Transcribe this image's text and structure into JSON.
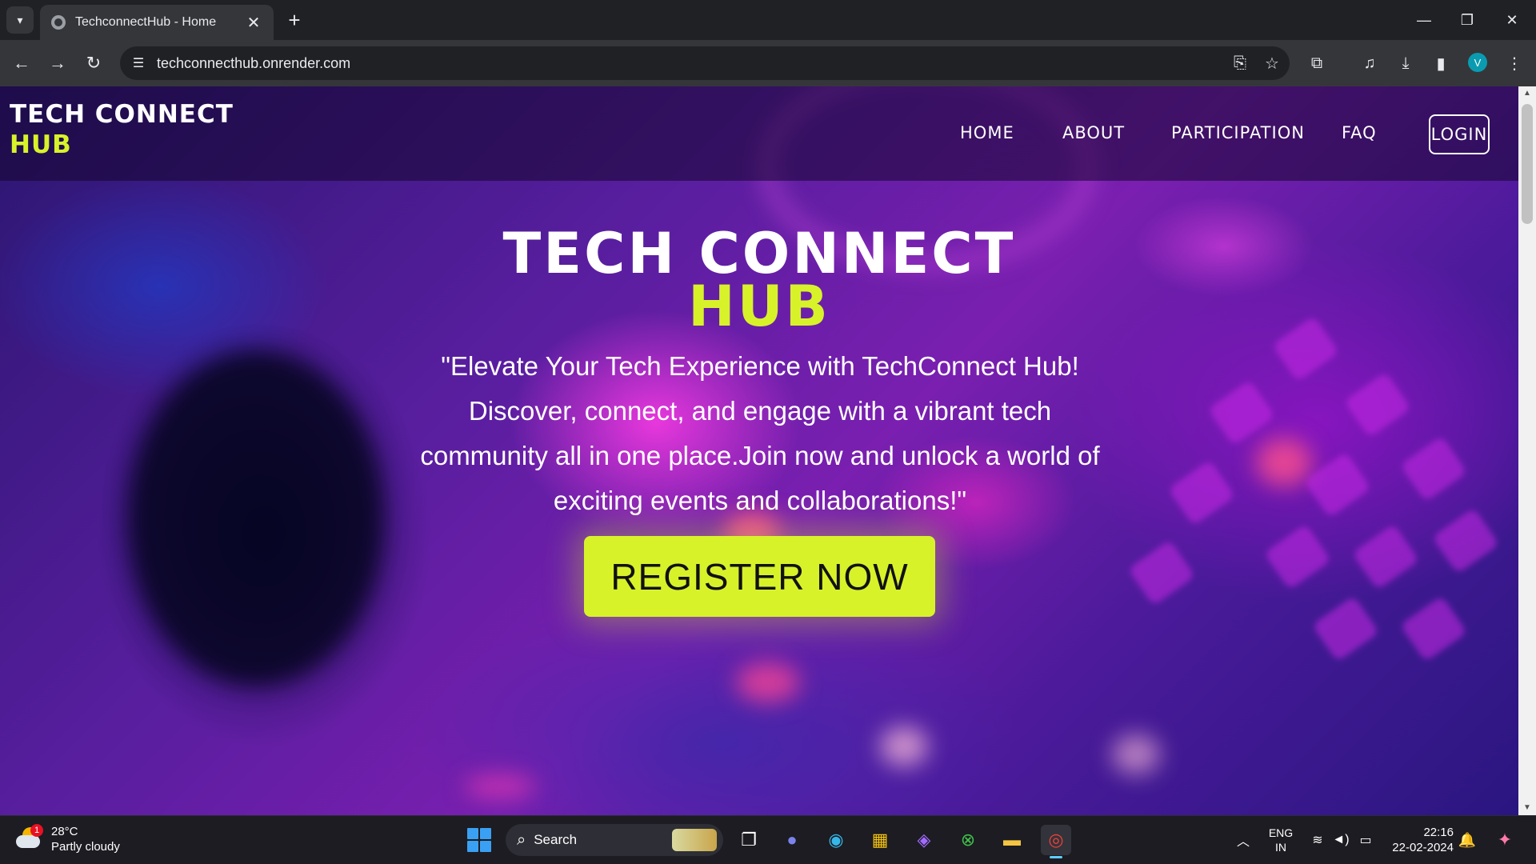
{
  "browser": {
    "tab_title": "TechconnectHub - Home",
    "url": "techconnecthub.onrender.com",
    "profile_initial": "V",
    "new_tab_symbol": "+",
    "close_symbol": "✕"
  },
  "site": {
    "logo_line1": "TECH CONNECT",
    "logo_line2": "HUB",
    "nav": {
      "home": "HOME",
      "about": "ABOUT",
      "participation": "PARTICIPATION",
      "faq": "FAQ",
      "login": "LOGIN"
    },
    "hero": {
      "title_line1": "TECH CONNECT",
      "title_line2": "HUB",
      "tagline": "\"Elevate Your Tech Experience with TechConnect Hub! Discover, connect, and engage with a vibrant tech community all in one place.Join now and unlock a world of exciting events and collaborations!\"",
      "cta": "REGISTER NOW"
    },
    "colors": {
      "accent": "#d8f22a",
      "white": "#ffffff"
    }
  },
  "taskbar": {
    "weather_temp": "28°C",
    "weather_desc": "Partly cloudy",
    "weather_badge": "1",
    "search_label": "Search",
    "lang_line1": "ENG",
    "lang_line2": "IN",
    "time": "22:16",
    "date": "22-02-2024"
  }
}
